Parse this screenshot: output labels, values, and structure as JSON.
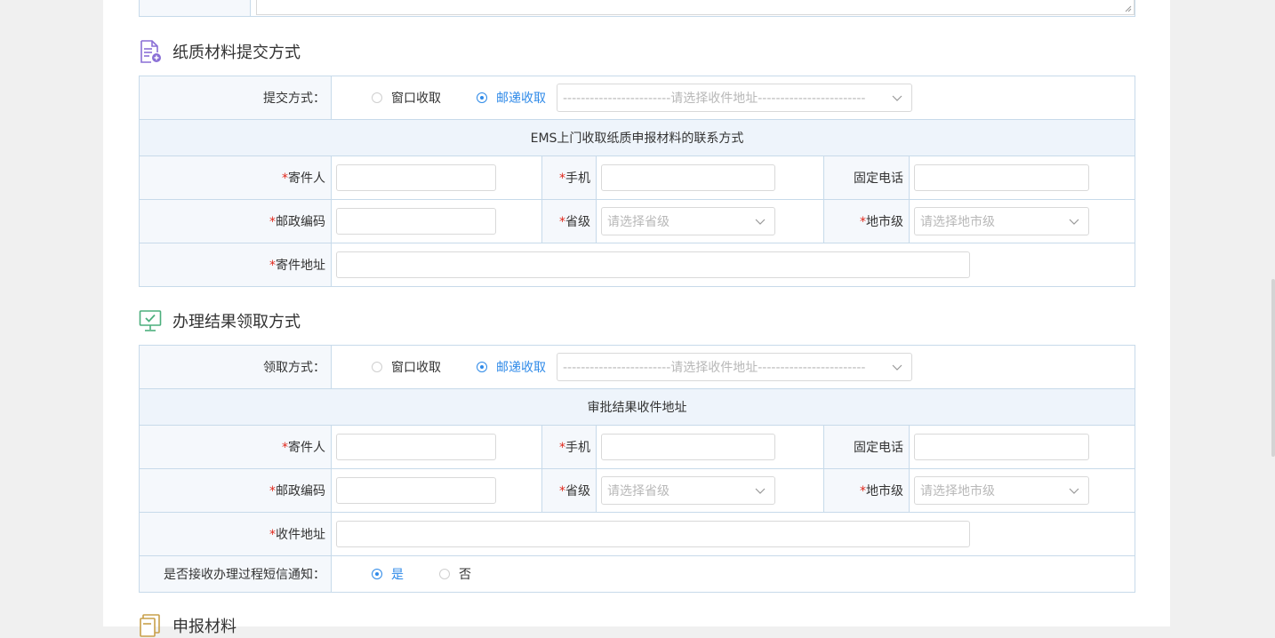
{
  "section1": {
    "title": "纸质材料提交方式",
    "method_label": "提交方式：",
    "option_window": "窗口收取",
    "option_mail": "邮递收取",
    "address_placeholder": "------------------------请选择收件地址------------------------",
    "subheader": "EMS上门收取纸质申报材料的联系方式",
    "sender_label": "寄件人",
    "phone_label": "手机",
    "landline_label": "固定电话",
    "postcode_label": "邮政编码",
    "province_label": "省级",
    "province_placeholder": "请选择省级",
    "city_label": "地市级",
    "city_placeholder": "请选择地市级",
    "address_label": "寄件地址",
    "selected": "邮递收取"
  },
  "section2": {
    "title": "办理结果领取方式",
    "method_label": "领取方式：",
    "option_window": "窗口收取",
    "option_mail": "邮递收取",
    "address_placeholder": "------------------------请选择收件地址------------------------",
    "subheader": "审批结果收件地址",
    "sender_label": "寄件人",
    "phone_label": "手机",
    "landline_label": "固定电话",
    "postcode_label": "邮政编码",
    "province_label": "省级",
    "province_placeholder": "请选择省级",
    "city_label": "地市级",
    "city_placeholder": "请选择地市级",
    "address_label": "收件地址",
    "sms_label": "是否接收办理过程短信通知：",
    "sms_yes": "是",
    "sms_no": "否",
    "selected": "邮递收取",
    "sms_selected": "是"
  },
  "section3": {
    "title": "申报材料"
  },
  "required_mark": "*",
  "colors": {
    "accent": "#2f8ae8",
    "required": "#e0281b",
    "border": "#c7daea",
    "label_bg": "#f5f8fc"
  }
}
